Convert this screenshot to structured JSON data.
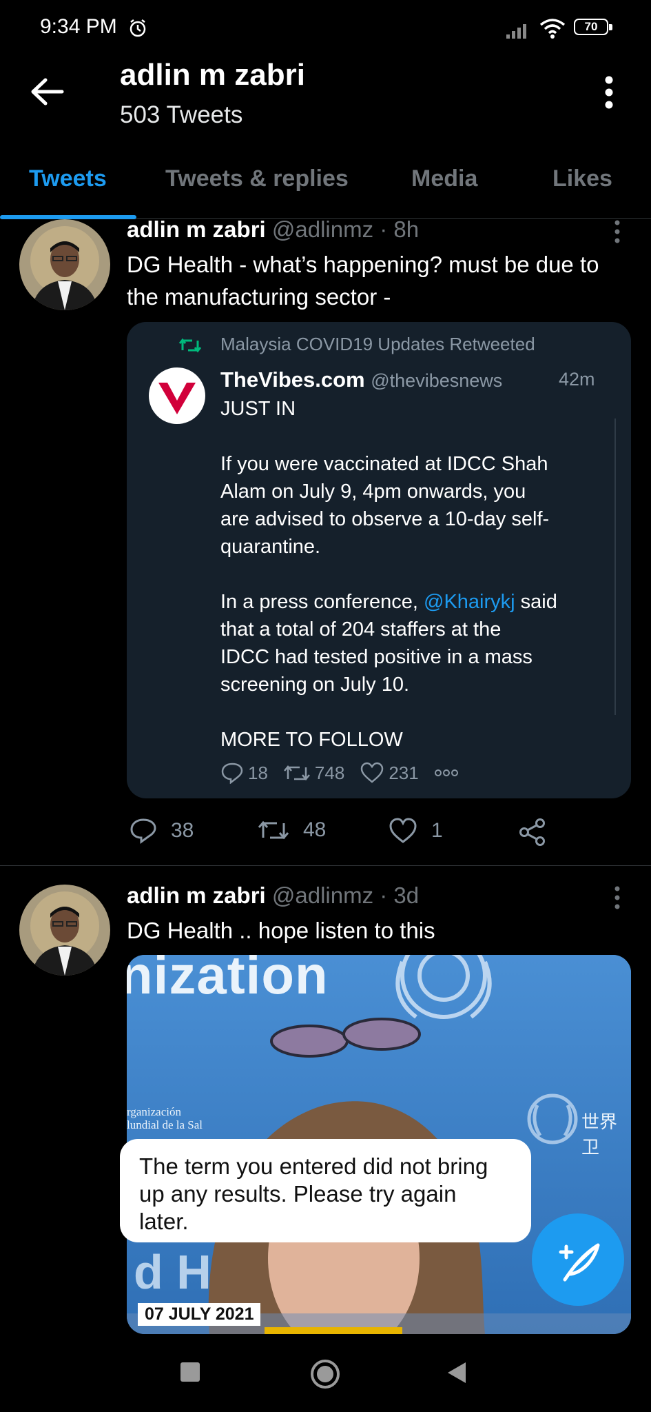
{
  "status_bar": {
    "time": "9:34 PM",
    "battery": "70"
  },
  "header": {
    "name": "adlin m zabri",
    "tweet_count": "503 Tweets"
  },
  "tabs": [
    {
      "label": "Tweets",
      "active": true
    },
    {
      "label": "Tweets & replies",
      "active": false
    },
    {
      "label": "Media",
      "active": false
    },
    {
      "label": "Likes",
      "active": false
    }
  ],
  "tweets": [
    {
      "name": "adlin m zabri",
      "handle_time": "@adlinmz · 8h",
      "text_line1": "DG Health - what’s happening? must be due to",
      "text_line2": "the manufacturing sector -",
      "quote": {
        "retweeted_by": "Malaysia COVID19 Updates Retweeted",
        "source_name": "TheVibes.com",
        "source_handle": "@thevibesnews",
        "time": "42m",
        "line_just_in": "JUST IN",
        "para1": [
          "If you were vaccinated at IDCC Shah",
          "Alam on July 9, 4pm onwards, you",
          "are advised to observe a 10-day self-",
          "quarantine."
        ],
        "para2_line1_prefix": "In a press conference, ",
        "para2_mention": "@Khairykj",
        "para2_line1_suffix": " said",
        "para2_rest": [
          "that a total of 204 staffers at the",
          "IDCC had tested positive in a mass",
          "screening on July 10."
        ],
        "more": "MORE TO FOLLOW",
        "replies": "18",
        "retweets": "748",
        "likes": "231"
      },
      "replies": "38",
      "retweets": "48",
      "likes": "1"
    },
    {
      "name": "adlin m zabri",
      "handle_time": "@adlinmz · 3d",
      "text_line1": "DG Health .. hope listen to this",
      "media": {
        "banner_text": "nization",
        "side_text_1": "rganización",
        "side_text_2": "lundial de la Sal",
        "logo_text": "世界卫",
        "lower_text": "d H",
        "date_badge": "07 JULY 2021"
      }
    }
  ],
  "toast": {
    "text": "The term you entered did not bring up any results. Please try again later."
  },
  "colors": {
    "accent": "#1d9bf0",
    "background": "#000000",
    "secondary_text": "#71767b",
    "retweet_green": "#00ba7c"
  }
}
